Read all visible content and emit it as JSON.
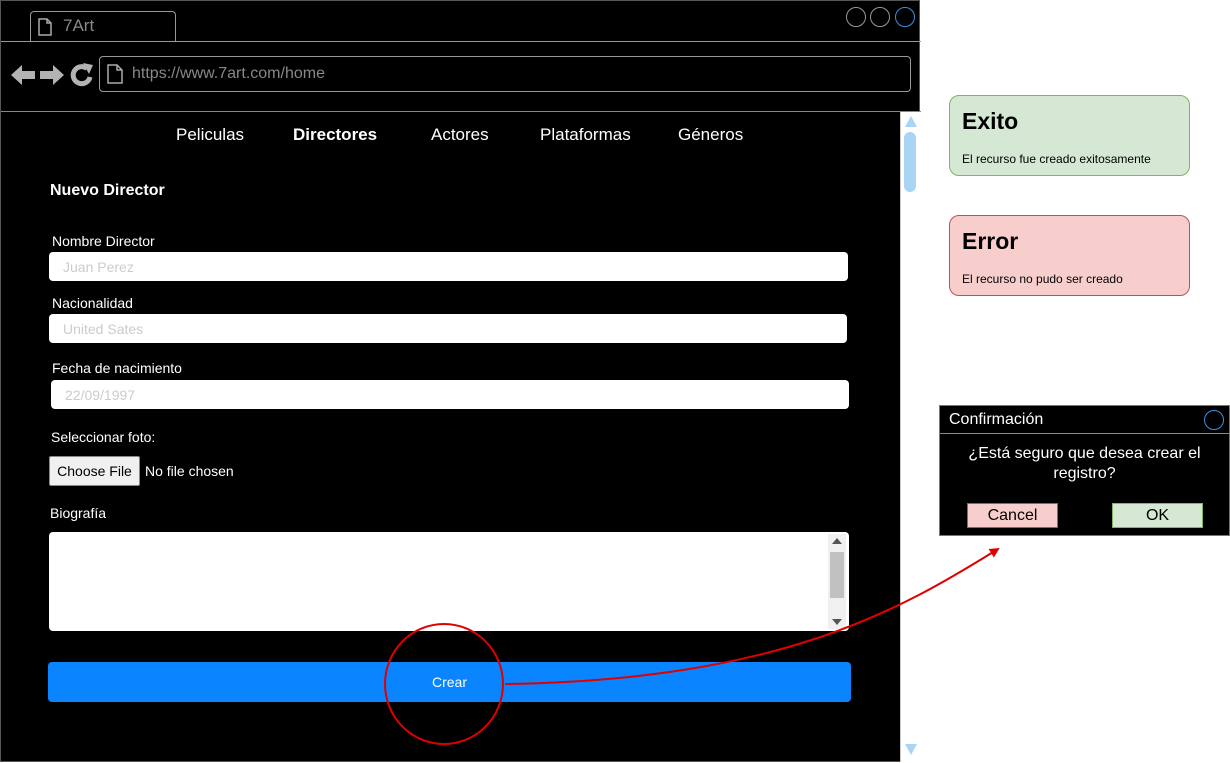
{
  "browser": {
    "tab_title": "7Art",
    "url": "https://www.7art.com/home",
    "icons": [
      "page-icon",
      "back-arrow-icon",
      "forward-arrow-icon",
      "reload-icon",
      "window-circle-icon"
    ]
  },
  "nav": {
    "items": [
      {
        "label": "Peliculas",
        "active": false
      },
      {
        "label": "Directores",
        "active": true
      },
      {
        "label": "Actores",
        "active": false
      },
      {
        "label": "Plataformas",
        "active": false
      },
      {
        "label": "Géneros",
        "active": false
      }
    ]
  },
  "form": {
    "title": "Nuevo Director",
    "nombre": {
      "label": "Nombre Director",
      "placeholder": "Juan Perez"
    },
    "nacionalidad": {
      "label": "Nacionalidad",
      "placeholder": "United Sates"
    },
    "fecha": {
      "label": "Fecha de nacimiento",
      "placeholder": "22/09/1997"
    },
    "foto": {
      "label": "Seleccionar foto:",
      "button_label": "Choose File",
      "status": "No file chosen"
    },
    "biografia": {
      "label": "Biografía"
    },
    "submit_label": "Crear"
  },
  "notifications": {
    "success": {
      "title": "Exito",
      "message": "El recurso fue creado exitosamente"
    },
    "error": {
      "title": "Error",
      "message": "El recurso no pudo ser creado"
    }
  },
  "dialog": {
    "title": "Confirmación",
    "question": "¿Está seguro que desea crear el registro?",
    "cancel_label": "Cancel",
    "ok_label": "OK"
  },
  "colors": {
    "accent": "#0a84ff",
    "success_bg": "#d5e8d4",
    "success_border": "#82b366",
    "error_bg": "#f8cecc",
    "error_border": "#b85450",
    "annotation": "#e00000"
  }
}
